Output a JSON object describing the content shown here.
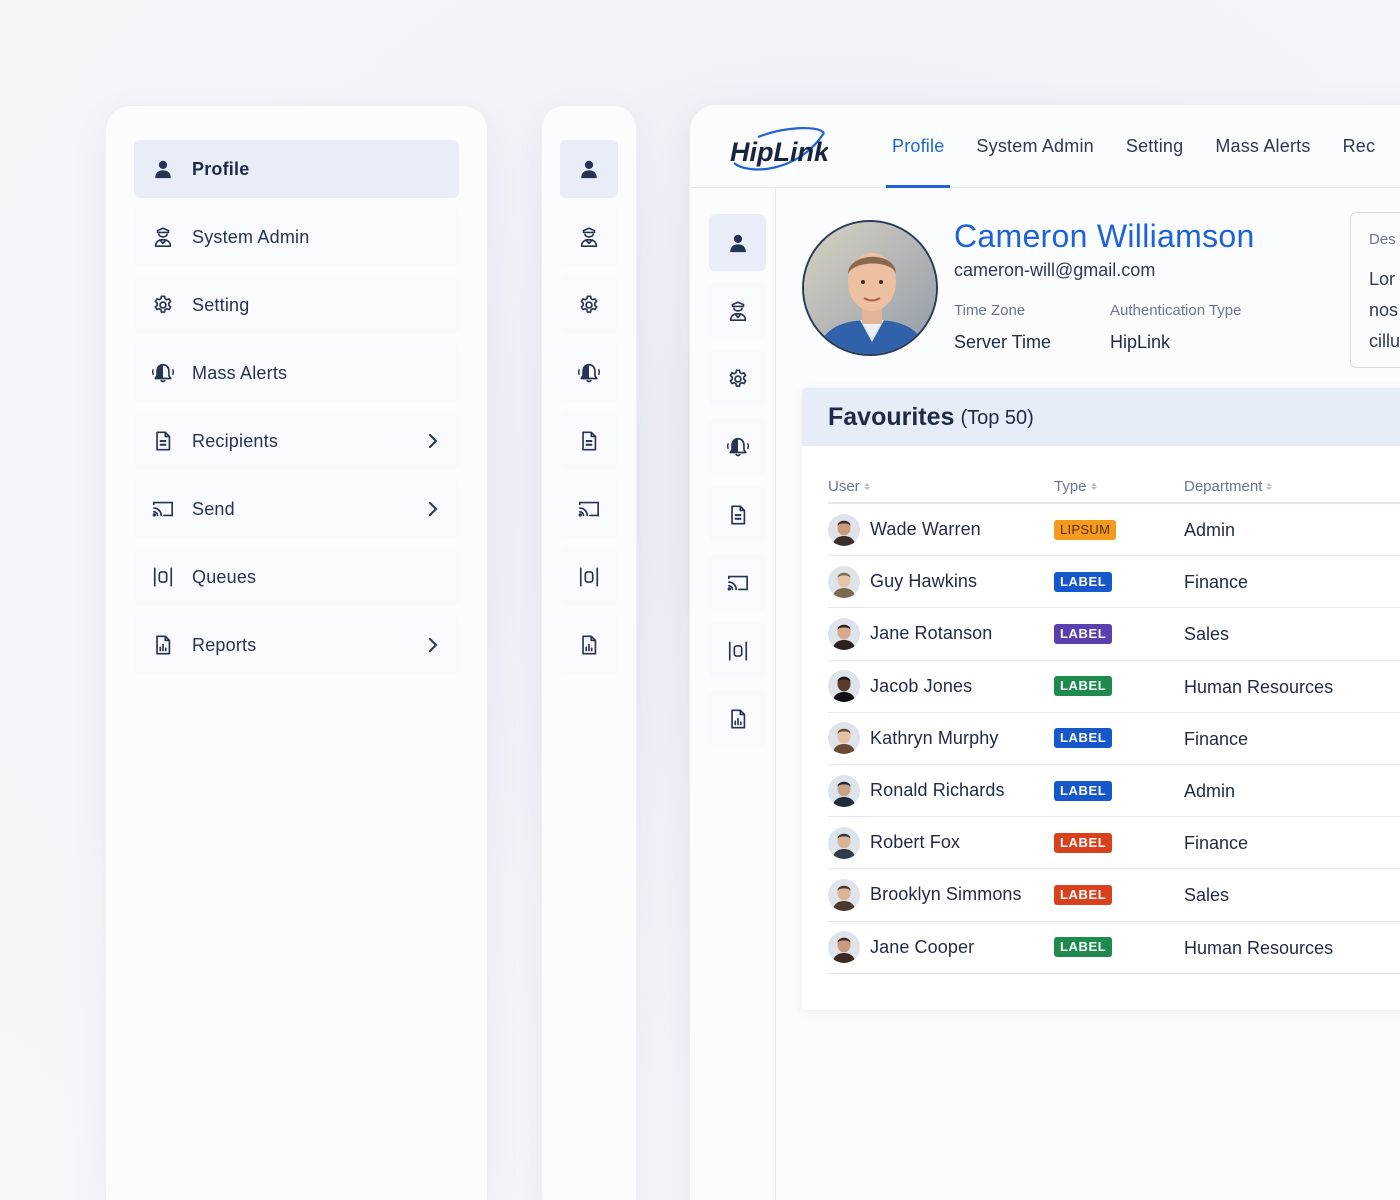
{
  "nav": {
    "items": [
      {
        "label": "Profile",
        "icon": "user-icon",
        "active": true,
        "chevron": false
      },
      {
        "label": "System Admin",
        "icon": "admin-icon",
        "active": false,
        "chevron": false
      },
      {
        "label": "Setting",
        "icon": "gear-icon",
        "active": false,
        "chevron": false
      },
      {
        "label": "Mass Alerts",
        "icon": "bell-icon",
        "active": false,
        "chevron": false
      },
      {
        "label": "Recipients",
        "icon": "document-icon",
        "active": false,
        "chevron": true
      },
      {
        "label": "Send",
        "icon": "cast-icon",
        "active": false,
        "chevron": true
      },
      {
        "label": "Queues",
        "icon": "queue-icon",
        "active": false,
        "chevron": false
      },
      {
        "label": "Reports",
        "icon": "report-icon",
        "active": false,
        "chevron": true
      }
    ]
  },
  "app": {
    "logo_text": "HipLink",
    "tabs": [
      "Profile",
      "System Admin",
      "Setting",
      "Mass Alerts",
      "Rec"
    ],
    "active_tab": "Profile",
    "accent": "#1d63d6"
  },
  "profile": {
    "name": "Cameron Williamson",
    "email": "cameron-will@gmail.com",
    "time_zone_label": "Time Zone",
    "time_zone_value": "Server Time",
    "auth_label": "Authentication Type",
    "auth_value": "HipLink",
    "desc_title": "Des",
    "desc_lines": [
      "Lor",
      "nos",
      "cillu"
    ]
  },
  "favourites": {
    "title": "Favourites",
    "subtitle": "(Top 50)",
    "columns": [
      "User",
      "Type",
      "Department"
    ],
    "rows": [
      {
        "user": "Wade Warren",
        "type": "LIPSUM",
        "color": "orange",
        "dept": "Admin"
      },
      {
        "user": "Guy Hawkins",
        "type": "LABEL",
        "color": "blue",
        "dept": "Finance"
      },
      {
        "user": "Jane Rotanson",
        "type": "LABEL",
        "color": "purple",
        "dept": "Sales"
      },
      {
        "user": "Jacob Jones",
        "type": "LABEL",
        "color": "green",
        "dept": "Human Resources"
      },
      {
        "user": "Kathryn Murphy",
        "type": "LABEL",
        "color": "blue",
        "dept": "Finance"
      },
      {
        "user": "Ronald Richards",
        "type": "LABEL",
        "color": "blue",
        "dept": "Admin"
      },
      {
        "user": "Robert Fox",
        "type": "LABEL",
        "color": "red",
        "dept": "Finance"
      },
      {
        "user": "Brooklyn Simmons",
        "type": "LABEL",
        "color": "red",
        "dept": "Sales"
      },
      {
        "user": "Jane Cooper",
        "type": "LABEL",
        "color": "green",
        "dept": "Human Resources"
      }
    ]
  }
}
